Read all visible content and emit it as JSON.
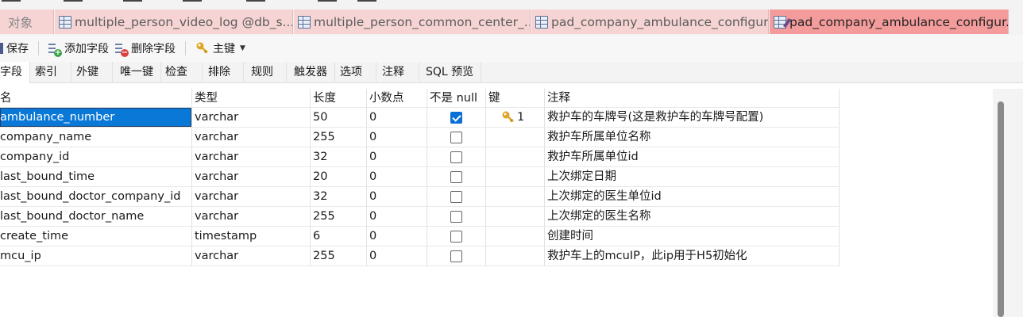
{
  "tabs": {
    "objects": "对象",
    "items": [
      {
        "label": "multiple_person_video_log @db_s..."
      },
      {
        "label": "multiple_person_common_center_..."
      },
      {
        "label": "pad_company_ambulance_configur..."
      },
      {
        "label": "pad_company_ambulance_configur..."
      }
    ]
  },
  "toolbar": {
    "save": "保存",
    "add_field": "添加字段",
    "delete_field": "删除字段",
    "primary_key": "主键"
  },
  "subtabs": [
    "字段",
    "索引",
    "外键",
    "唯一键",
    "检查",
    "排除",
    "规则",
    "触发器",
    "选项",
    "注释",
    "SQL 预览"
  ],
  "columns": {
    "name": "名",
    "type": "类型",
    "length": "长度",
    "decimal": "小数点",
    "not_null": "不是 null",
    "key": "键",
    "comment": "注释"
  },
  "rows": [
    {
      "name": "ambulance_number",
      "type": "varchar",
      "length": "50",
      "decimal": "0",
      "not_null": true,
      "key": "1",
      "comment": "救护车的车牌号(这是救护车的车牌号配置)"
    },
    {
      "name": "company_name",
      "type": "varchar",
      "length": "255",
      "decimal": "0",
      "not_null": false,
      "key": "",
      "comment": "救护车所属单位名称"
    },
    {
      "name": "company_id",
      "type": "varchar",
      "length": "32",
      "decimal": "0",
      "not_null": false,
      "key": "",
      "comment": "救护车所属单位id"
    },
    {
      "name": "last_bound_time",
      "type": "varchar",
      "length": "20",
      "decimal": "0",
      "not_null": false,
      "key": "",
      "comment": "上次绑定日期"
    },
    {
      "name": "last_bound_doctor_company_id",
      "type": "varchar",
      "length": "32",
      "decimal": "0",
      "not_null": false,
      "key": "",
      "comment": "上次绑定的医生单位id"
    },
    {
      "name": "last_bound_doctor_name",
      "type": "varchar",
      "length": "255",
      "decimal": "0",
      "not_null": false,
      "key": "",
      "comment": "上次绑定的医生名称"
    },
    {
      "name": "create_time",
      "type": "timestamp",
      "length": "6",
      "decimal": "0",
      "not_null": false,
      "key": "",
      "comment": "创建时间"
    },
    {
      "name": "mcu_ip",
      "type": "varchar",
      "length": "255",
      "decimal": "0",
      "not_null": false,
      "key": "",
      "comment": "救护车上的mcuIP，此ip用于H5初始化"
    }
  ],
  "colors": {
    "active_tab": "#f49b9b",
    "inactive_tab": "#f6d4d4",
    "selection": "#0a78d7",
    "checkbox_on": "#0a6fd6",
    "key_icon": "#e0a526"
  }
}
